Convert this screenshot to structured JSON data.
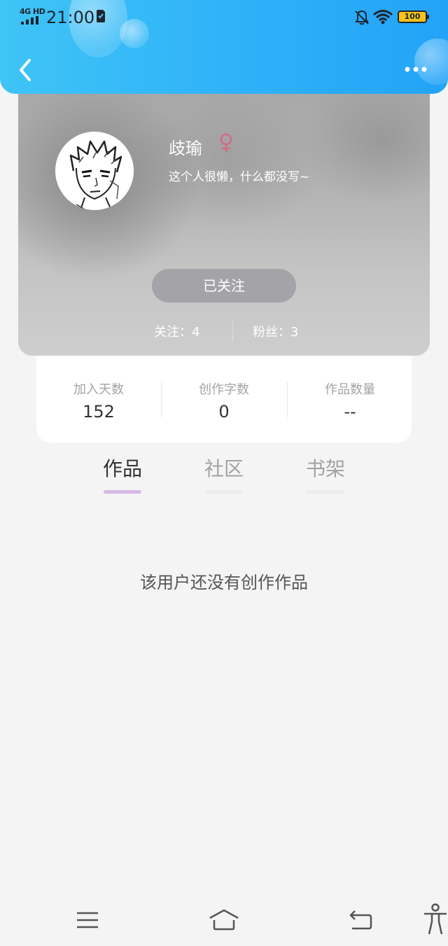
{
  "status_bar": {
    "network": "4G HD",
    "time": "21:00",
    "battery": "100"
  },
  "header": {
    "back_icon": "chevron-left-icon",
    "more_icon": "more-dots-icon",
    "gradient_colors": [
      "#3fc4f6",
      "#23a3f7"
    ]
  },
  "profile": {
    "name": "歧瑜",
    "gender_icon": "female-icon",
    "gender_color": "#d46a85",
    "bio": "这个人很懒，什么都没写~",
    "follow_button": "已关注",
    "following": "关注：4",
    "fans": "粉丝：3"
  },
  "stats": [
    {
      "label": "加入天数",
      "value": "152"
    },
    {
      "label": "创作字数",
      "value": "0"
    },
    {
      "label": "作品数量",
      "value": "--"
    }
  ],
  "tabs": [
    {
      "label": "作品",
      "active": true
    },
    {
      "label": "社区",
      "active": false
    },
    {
      "label": "书架",
      "active": false
    }
  ],
  "empty_message": "该用户还没有创作作品",
  "accent_color": "#d7b8e6",
  "bottom_nav": [
    "menu-icon",
    "home-icon",
    "back-icon",
    "accessibility-icon"
  ]
}
